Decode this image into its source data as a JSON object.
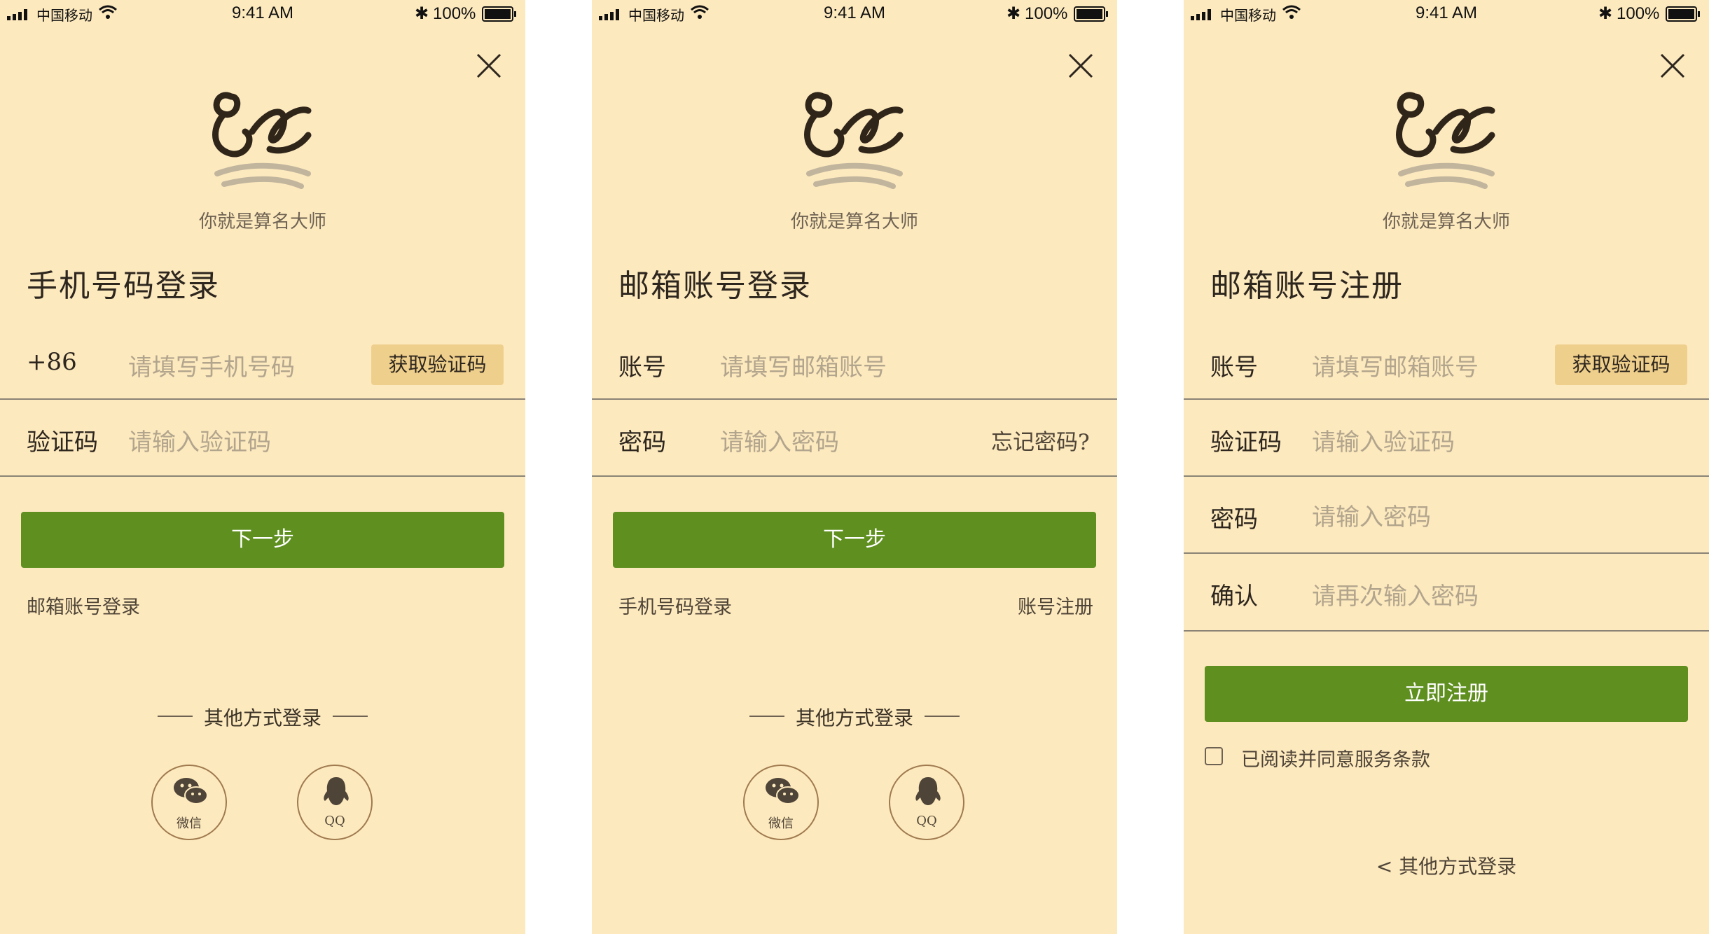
{
  "colors": {
    "background": "#fde9be",
    "primary_button": "#5e8f1f",
    "code_button": "#efcf8c",
    "placeholder": "#b2a58d"
  },
  "status_bar": {
    "carrier": "中国移动",
    "time": "9:41 AM",
    "battery": "100%"
  },
  "logo": {
    "slogan": "你就是算名大师"
  },
  "screens": [
    {
      "title": "手机号码登录",
      "fields": [
        {
          "label": "+86",
          "placeholder": "请填写手机号码",
          "action": "获取验证码"
        },
        {
          "label": "验证码",
          "placeholder": "请输入验证码"
        }
      ],
      "primary_button": "下一步",
      "link_left": "邮箱账号登录",
      "other_login": "其他方式登录",
      "social": [
        {
          "label": "微信",
          "icon": "wechat-icon"
        },
        {
          "label": "QQ",
          "icon": "qq-icon"
        }
      ]
    },
    {
      "title": "邮箱账号登录",
      "fields": [
        {
          "label": "账号",
          "placeholder": "请填写邮箱账号"
        },
        {
          "label": "密码",
          "placeholder": "请输入密码",
          "action": "忘记密码?"
        }
      ],
      "primary_button": "下一步",
      "link_left": "手机号码登录",
      "link_right": "账号注册",
      "other_login": "其他方式登录",
      "social": [
        {
          "label": "微信",
          "icon": "wechat-icon"
        },
        {
          "label": "QQ",
          "icon": "qq-icon"
        }
      ]
    },
    {
      "title": "邮箱账号注册",
      "fields": [
        {
          "label": "账号",
          "placeholder": "请填写邮箱账号",
          "action": "获取验证码"
        },
        {
          "label": "验证码",
          "placeholder": "请输入验证码"
        },
        {
          "label": "密码",
          "placeholder": "请输入密码"
        },
        {
          "label": "确认",
          "placeholder": "请再次输入密码"
        }
      ],
      "primary_button": "立即注册",
      "agreement": "已阅读并同意服务条款",
      "back_link": "< 其他方式登录"
    }
  ]
}
